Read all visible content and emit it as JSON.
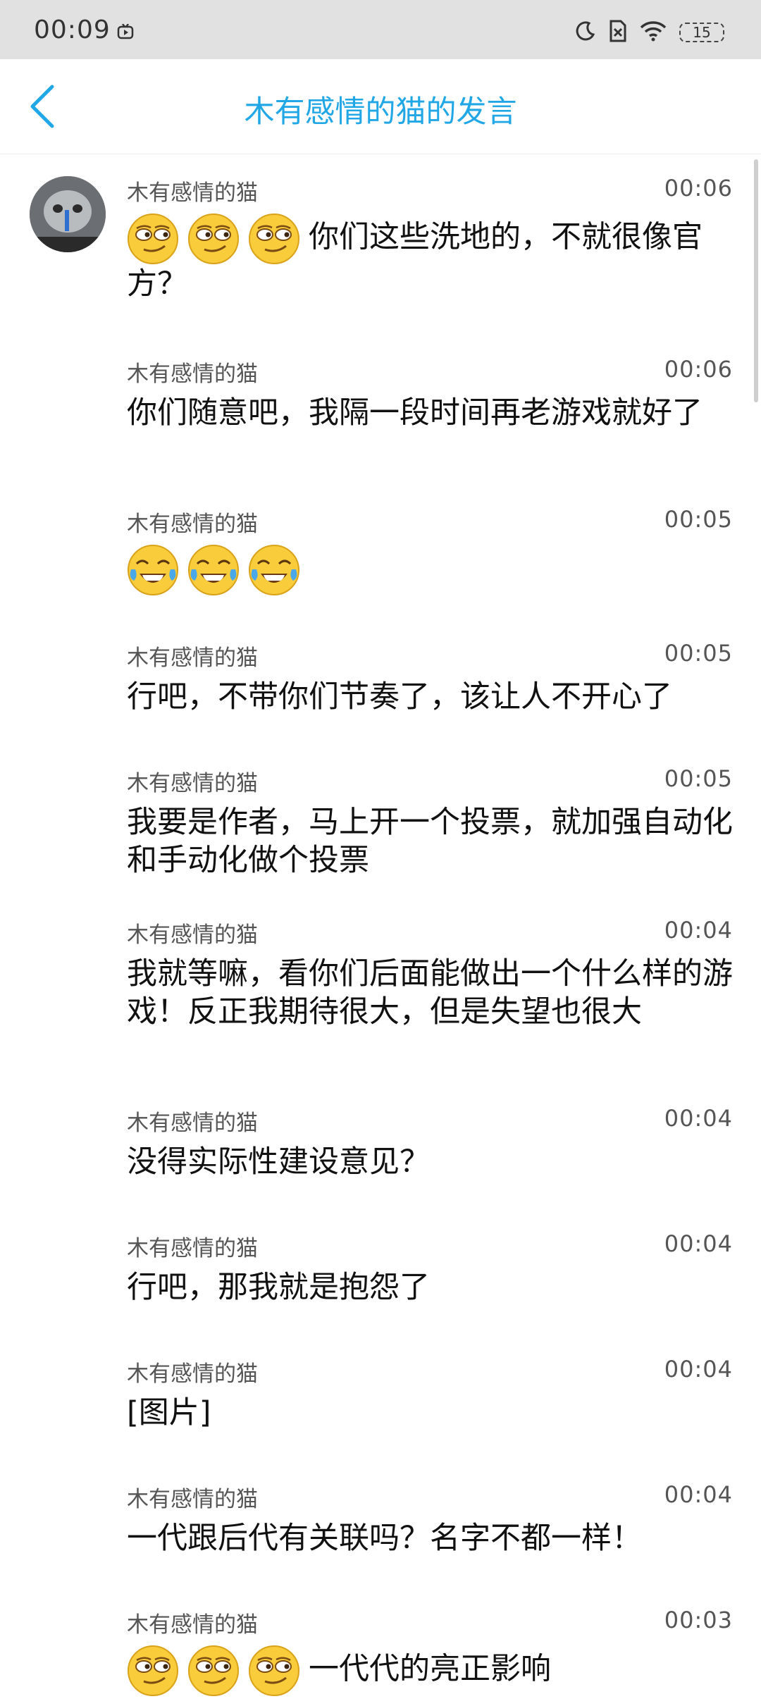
{
  "status_bar": {
    "time": "00:09",
    "battery": "15"
  },
  "nav": {
    "title": "木有感情的猫的发言"
  },
  "messages": [
    {
      "name": "木有感情的猫",
      "time": "00:06",
      "emojis": [
        "smirk",
        "smirk",
        "smirk"
      ],
      "text": "你们这些洗地的，不就很像官方？"
    },
    {
      "name": "木有感情的猫",
      "time": "00:06",
      "emojis": [],
      "text": "你们随意吧，我隔一段时间再老游戏就好了"
    },
    {
      "name": "木有感情的猫",
      "time": "00:05",
      "emojis": [
        "tears-of-joy",
        "tears-of-joy",
        "tears-of-joy"
      ],
      "text": ""
    },
    {
      "name": "木有感情的猫",
      "time": "00:05",
      "emojis": [],
      "text": "行吧，不带你们节奏了，该让人不开心了"
    },
    {
      "name": "木有感情的猫",
      "time": "00:05",
      "emojis": [],
      "text": "我要是作者，马上开一个投票，就加强自动化和手动化做个投票"
    },
    {
      "name": "木有感情的猫",
      "time": "00:04",
      "emojis": [],
      "text": "我就等嘛，看你们后面能做出一个什么样的游戏！反正我期待很大，但是失望也很大"
    },
    {
      "name": "木有感情的猫",
      "time": "00:04",
      "emojis": [],
      "text": "没得实际性建设意见？"
    },
    {
      "name": "木有感情的猫",
      "time": "00:04",
      "emojis": [],
      "text": "行吧，那我就是抱怨了"
    },
    {
      "name": "木有感情的猫",
      "time": "00:04",
      "emojis": [],
      "text": "[图片]"
    },
    {
      "name": "木有感情的猫",
      "time": "00:04",
      "emojis": [],
      "text": "一代跟后代有关联吗？名字不都一样！"
    },
    {
      "name": "木有感情的猫",
      "time": "00:03",
      "emojis": [
        "smirk",
        "smirk",
        "smirk"
      ],
      "text": "一代代的亮正影响"
    }
  ],
  "colors": {
    "accent": "#22a7e6",
    "status_bar_bg": "#e1e1e1"
  }
}
